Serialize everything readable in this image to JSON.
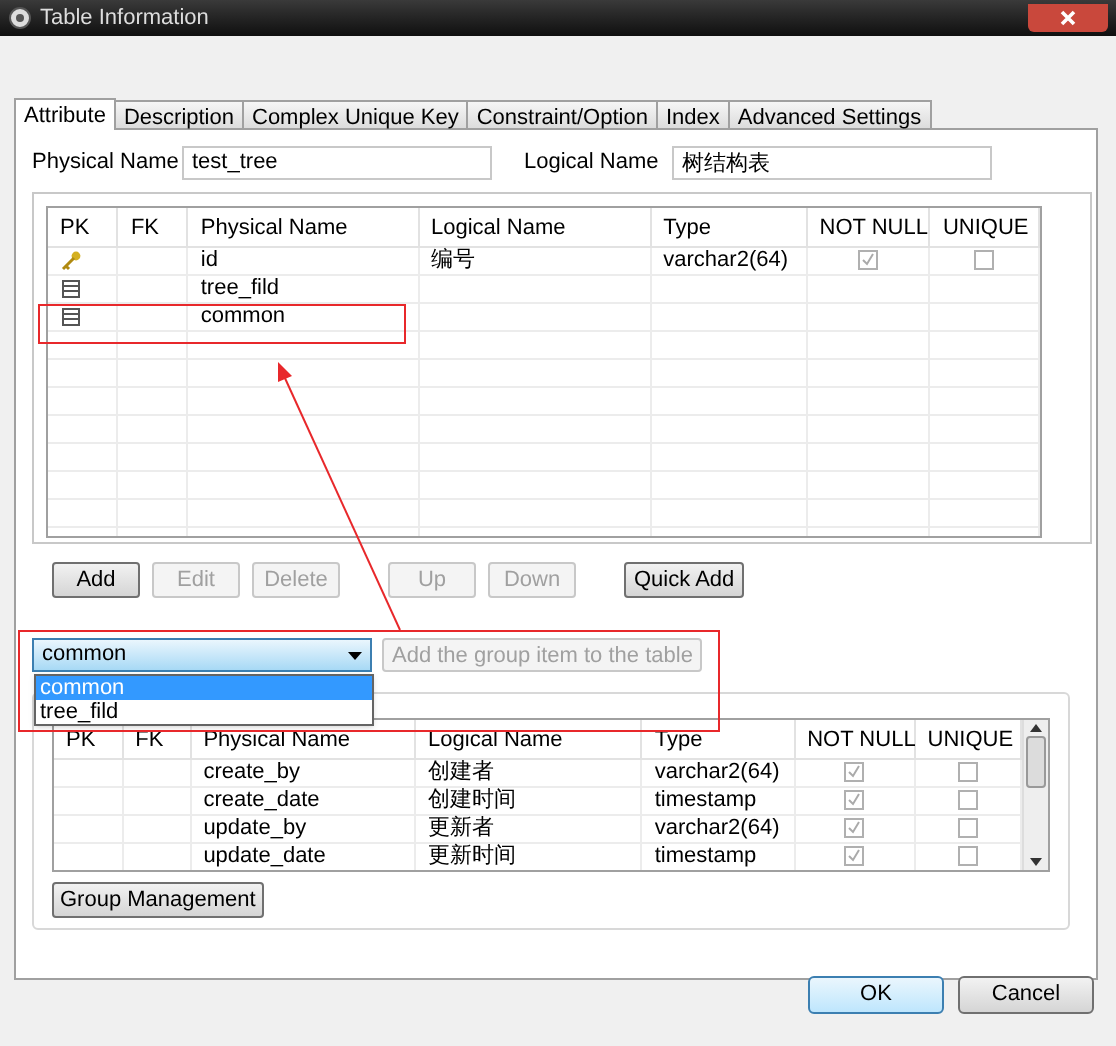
{
  "window": {
    "title": "Table Information"
  },
  "tabs": [
    {
      "label": "Attribute",
      "selected": true
    },
    {
      "label": "Description",
      "selected": false
    },
    {
      "label": "Complex Unique Key",
      "selected": false
    },
    {
      "label": "Constraint/Option",
      "selected": false
    },
    {
      "label": "Index",
      "selected": false
    },
    {
      "label": "Advanced Settings",
      "selected": false
    }
  ],
  "physical_name": {
    "label": "Physical Name",
    "value": "test_tree"
  },
  "logical_name": {
    "label": "Logical Name",
    "value": "树结构表"
  },
  "columns": {
    "columns": [
      "PK",
      "FK",
      "Physical Name",
      "Logical Name",
      "Type",
      "NOT NULL",
      "UNIQUE"
    ],
    "rows": [
      {
        "kind": "key",
        "physical_name": "id",
        "logical_name": "编号",
        "type": "varchar2(64)",
        "not_null": true,
        "unique": false
      },
      {
        "kind": "group",
        "physical_name": "tree_fild"
      },
      {
        "kind": "group",
        "physical_name": "common"
      }
    ]
  },
  "column_buttons": [
    {
      "label": "Add",
      "disabled": false
    },
    {
      "label": "Edit",
      "disabled": true
    },
    {
      "label": "Delete",
      "disabled": true
    },
    {
      "label": "Up",
      "disabled": true
    },
    {
      "label": "Down",
      "disabled": true
    },
    {
      "label": "Quick Add",
      "disabled": false
    }
  ],
  "group_combo": {
    "value": "common",
    "options": [
      {
        "label": "common",
        "selected": true
      },
      {
        "label": "tree_fild",
        "selected": false
      }
    ]
  },
  "add_group_button": {
    "label": "Add the group item to the table",
    "disabled": true
  },
  "group_table": {
    "columns": [
      "PK",
      "FK",
      "Physical Name",
      "Logical Name",
      "Type",
      "NOT NULL",
      "UNIQUE"
    ],
    "rows": [
      {
        "physical_name": "create_by",
        "logical_name": "创建者",
        "type": "varchar2(64)",
        "not_null": true,
        "unique": false
      },
      {
        "physical_name": "create_date",
        "logical_name": "创建时间",
        "type": "timestamp",
        "not_null": true,
        "unique": false
      },
      {
        "physical_name": "update_by",
        "logical_name": "更新者",
        "type": "varchar2(64)",
        "not_null": true,
        "unique": false
      },
      {
        "physical_name": "update_date",
        "logical_name": "更新时间",
        "type": "timestamp",
        "not_null": true,
        "unique": false
      }
    ]
  },
  "group_management_button": {
    "label": "Group Management"
  },
  "footer_buttons": [
    {
      "label": "OK",
      "default": true
    },
    {
      "label": "Cancel",
      "default": false
    }
  ]
}
